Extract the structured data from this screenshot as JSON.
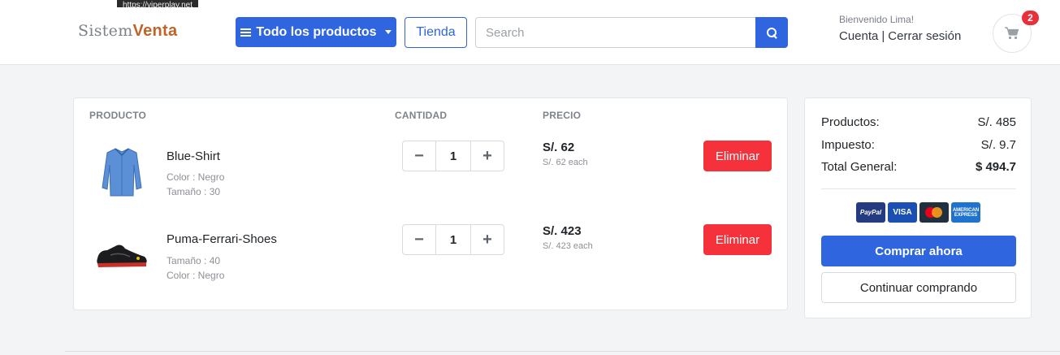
{
  "tooltip": "https://viperplay.net",
  "header": {
    "logo_part1": "Sistem",
    "logo_part2": "Venta",
    "products_button": "Todo los productos",
    "tienda_button": "Tienda",
    "search_placeholder": "Search",
    "welcome": "Bienvenido Lima!",
    "account_link": "Cuenta",
    "separator": "|",
    "logout_link": "Cerrar sesión",
    "cart_count": "2"
  },
  "table": {
    "headers": {
      "product": "PRODUCTO",
      "quantity": "CANTIDAD",
      "price": "PRECIO"
    },
    "rows": [
      {
        "name": "Blue-Shirt",
        "meta1": "Color : Negro",
        "meta2": "Tamaño : 30",
        "quantity": "1",
        "price": "S/. 62",
        "each": "S/. 62 each",
        "delete_label": "Eliminar",
        "image_icon": "shirt-icon"
      },
      {
        "name": "Puma-Ferrari-Shoes",
        "meta1": "Tamaño : 40",
        "meta2": "Color : Negro",
        "quantity": "1",
        "price": "S/. 423",
        "each": "S/. 423 each",
        "delete_label": "Eliminar",
        "image_icon": "shoe-icon"
      }
    ]
  },
  "summary": {
    "products_label": "Productos:",
    "products_value": "S/. 485",
    "tax_label": "Impuesto:",
    "tax_value": "S/. 9.7",
    "total_label": "Total General:",
    "total_value": "$ 494.7",
    "payment_methods": [
      "PayPal",
      "VISA",
      "Mastercard",
      "AMERICAN EXPRESS"
    ],
    "buy_button": "Comprar ahora",
    "continue_button": "Continuar comprando"
  },
  "colors": {
    "primary": "#2f66e0",
    "danger": "#f5323b",
    "logo_accent": "#c0642a",
    "badge": "#e9303a"
  }
}
